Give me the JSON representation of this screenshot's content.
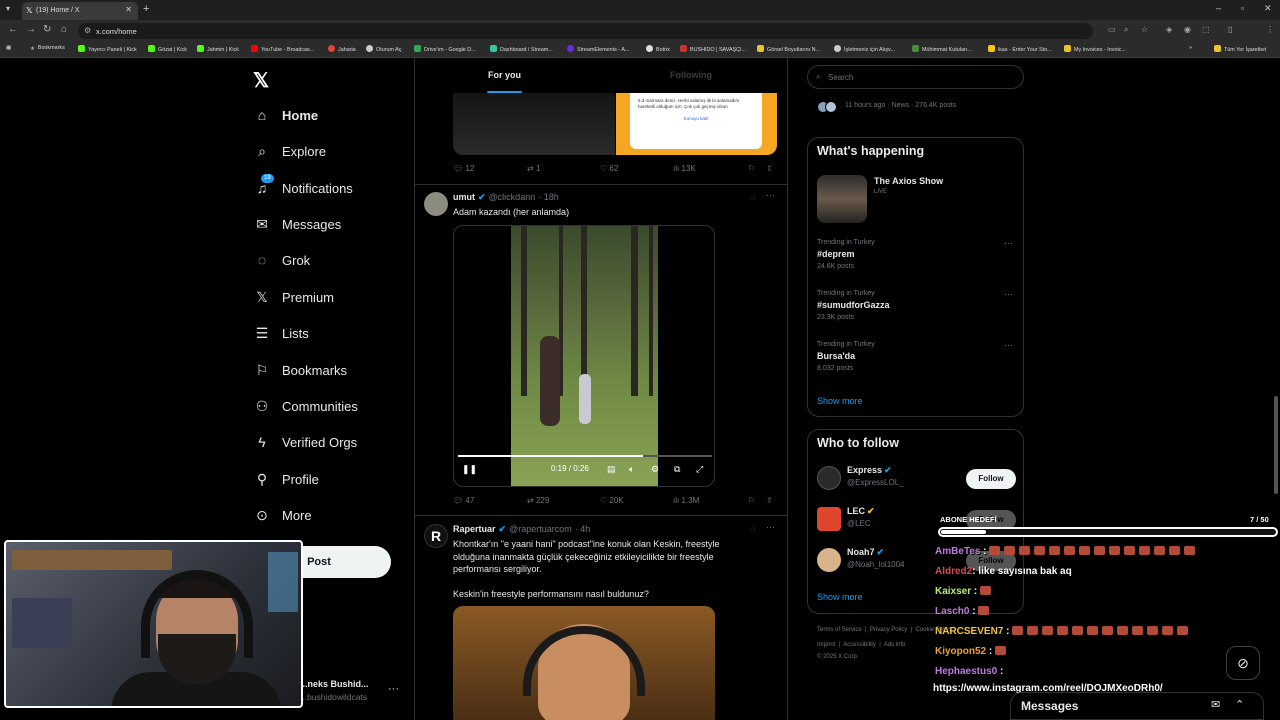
{
  "browser": {
    "tab_title": "(19) Home / X",
    "url": "x.com/home",
    "bookmarks": [
      {
        "label": "Bookmarks",
        "color": "#888888"
      },
      {
        "label": "Yayıncı Paneli | Kick",
        "color": "#53fc18"
      },
      {
        "label": "Gözat | Kick",
        "color": "#53fc18"
      },
      {
        "label": "Jahmin | Kick",
        "color": "#53fc18"
      },
      {
        "label": "YouTube - Broadcas...",
        "color": "#ff0000"
      },
      {
        "label": "Jaharia",
        "color": "#e0463a"
      },
      {
        "label": "Oturum Aç",
        "color": "#cccccc"
      },
      {
        "label": "Drive'ım - Google D...",
        "color": "#34a853"
      },
      {
        "label": "Dashboard / Stream...",
        "color": "#36c5a0"
      },
      {
        "label": "StreamElements - A...",
        "color": "#6c2bd9"
      },
      {
        "label": "Botrix",
        "color": "#dddddd"
      },
      {
        "label": "BUSHIDO | SAVAŞÇI...",
        "color": "#d03030"
      },
      {
        "label": "Görsel Boyutlarını N...",
        "color": "#e8c32c"
      },
      {
        "label": "İşletmeniz için Alışv...",
        "color": "#cccccc"
      },
      {
        "label": "Mühimmat Kutuları...",
        "color": "#4a8c3a"
      },
      {
        "label": "ikas - Enter Your Sto...",
        "color": "#f5c518"
      },
      {
        "label": "My Invoices - Invoic...",
        "color": "#e8c32c"
      },
      {
        "label": "Tüm Yer İşaretleri",
        "color": "#e8c32c"
      }
    ]
  },
  "nav": {
    "items": [
      {
        "label": "Home",
        "icon": "home-icon",
        "active": true
      },
      {
        "label": "Explore",
        "icon": "search-icon"
      },
      {
        "label": "Notifications",
        "icon": "bell-icon",
        "badge": "19"
      },
      {
        "label": "Messages",
        "icon": "envelope-icon"
      },
      {
        "label": "Grok",
        "icon": "grok-icon"
      },
      {
        "label": "Premium",
        "icon": "x-icon"
      },
      {
        "label": "Lists",
        "icon": "list-icon"
      },
      {
        "label": "Bookmarks",
        "icon": "bookmark-icon"
      },
      {
        "label": "Communities",
        "icon": "communities-icon"
      },
      {
        "label": "Verified Orgs",
        "icon": "lightning-icon"
      },
      {
        "label": "Profile",
        "icon": "person-icon"
      },
      {
        "label": "More",
        "icon": "more-circle-icon"
      }
    ],
    "post_label": "Post",
    "account_name": "...neks Bushid...",
    "account_handle": "...bushidowildcats"
  },
  "timeline": {
    "tab_for_you": "For you",
    "tab_following": "Following",
    "prev_post": {
      "card_text": "5.3 marmara deniz. Herbi salamış ilk bi anlamadım hareketli olduğum için. Çok çok geçmiş olsun",
      "card_link": "Konuyu katıl",
      "replies": "12",
      "reposts": "1",
      "likes": "62",
      "views": "13K"
    },
    "post1": {
      "name": "umut",
      "handle": "@clickdann",
      "time": "· 18h",
      "text": "Adam kazandı (her anlamda)",
      "video_time": "0:19 / 0:26",
      "progress": 0.73,
      "replies": "47",
      "reposts": "229",
      "likes": "20K",
      "views": "1.3M"
    },
    "post2": {
      "name": "Rapertuar",
      "handle": "@rapertuarcom",
      "time": "· 4h",
      "text1": "Khontkar'ın \"e yaani hani\" podcast\"ine konuk olan Keskin, freestyle olduğuna inanmakta güçlük çekeceğiniz etkileyicilikte bir freestyle performansı sergiliyor.",
      "text2": "Keskin'in freestyle performansını nasıl buldunuz?"
    }
  },
  "right": {
    "search_placeholder": "Search",
    "top_trend_meta": "11 hours ago · News · 276.4K posts",
    "happening_title": "What's happening",
    "live_name": "The Axios Show",
    "live_label": "LIVE",
    "trends": [
      {
        "context": "Trending in Turkey",
        "name": "#deprem",
        "count": "24.6K posts"
      },
      {
        "context": "Trending in Turkey",
        "name": "#sumudforGazza",
        "count": "23.3K posts"
      },
      {
        "context": "Trending in Turkey",
        "name": "Bursa'da",
        "count": "8,032 posts"
      }
    ],
    "show_more": "Show more",
    "wtf_title": "Who to follow",
    "wtf": [
      {
        "name": "Express",
        "handle": "@ExpressLOL_",
        "color": "#2a2a2a"
      },
      {
        "name": "LEC",
        "handle": "@LEC",
        "color": "#e0462d"
      },
      {
        "name": "Noah7",
        "handle": "@Noah_lol1004",
        "color": "#d9b48a"
      }
    ],
    "follow_label": "Follow",
    "footer1": [
      "Terms of Service",
      "Privacy Policy",
      "Cookie Policy"
    ],
    "footer2": [
      "Imprint",
      "Accessibility",
      "Ads info"
    ],
    "copyright": "© 2025 X Corp."
  },
  "overlay": {
    "sub_goal_label": "ABONE HEDEFİ",
    "sub_goal_count": "7 / 50",
    "sub_goal_progress": 0.14,
    "chat": [
      {
        "user": "AmBeTes",
        "color": "#c07adf",
        "msg": ":",
        "emotes": 14
      },
      {
        "user": "Aldred2",
        "color": "#e0464a",
        "msg": ": like sayısına bak aq",
        "emotes": 0
      },
      {
        "user": "Kaixser",
        "color": "#b6f07a",
        "msg": ":",
        "emotes": 1
      },
      {
        "user": "Lasch0",
        "color": "#c07adf",
        "msg": ":",
        "emotes": 1
      },
      {
        "user": "NARCSEVEN7",
        "color": "#f5c542",
        "msg": ":",
        "emotes": 12
      },
      {
        "user": "Kiyopon52",
        "color": "#f0a030",
        "msg": ":",
        "emotes": 1
      },
      {
        "user": "Hephaestus0",
        "color": "#c07adf",
        "msg": ":",
        "emotes": 0
      }
    ],
    "chat_link": "https://www.instagram.com/reel/DOJMXeoDRh0/",
    "messages_label": "Messages"
  }
}
